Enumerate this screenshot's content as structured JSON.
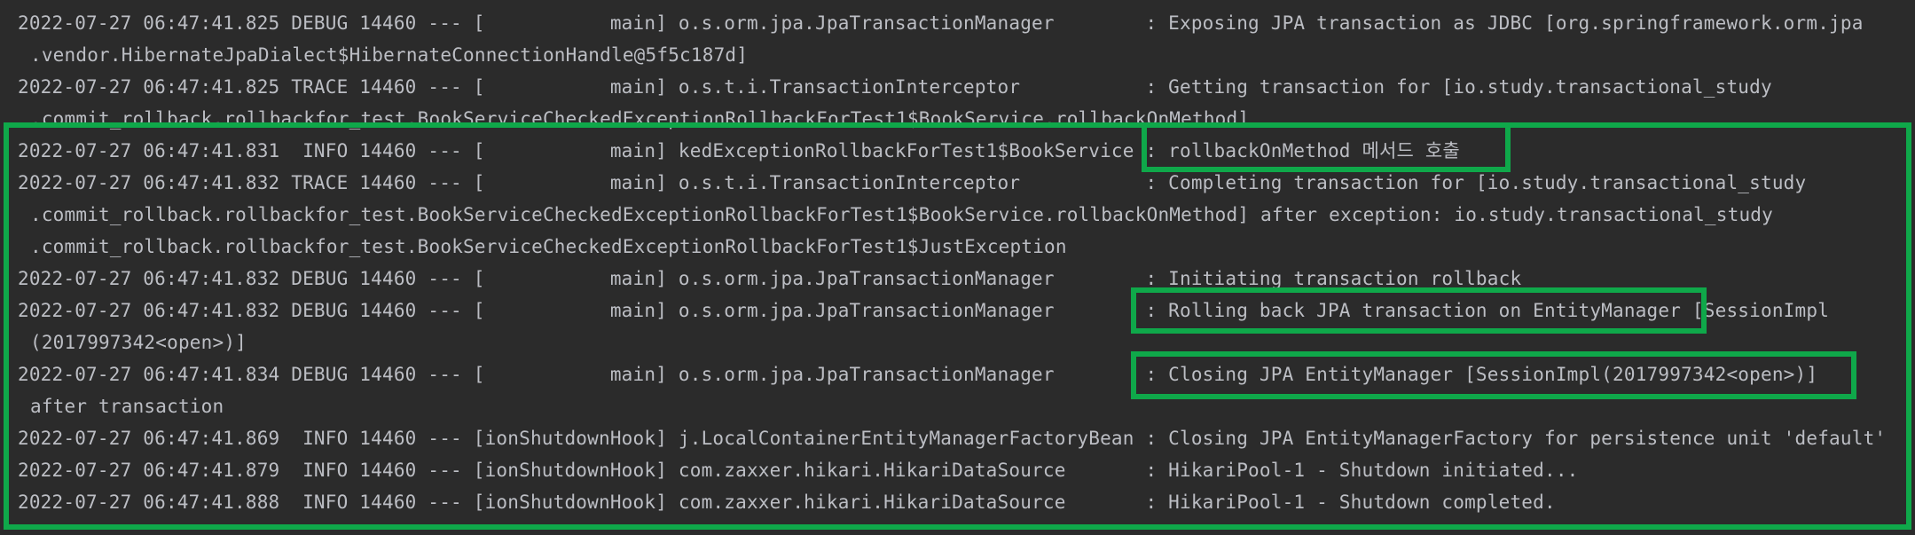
{
  "console": {
    "lines": [
      "2022-07-27 06:47:41.825 DEBUG 14460 --- [           main] o.s.orm.jpa.JpaTransactionManager        : Exposing JPA transaction as JDBC [org.springframework.orm.jpa",
      ".vendor.HibernateJpaDialect$HibernateConnectionHandle@5f5c187d]",
      "2022-07-27 06:47:41.825 TRACE 14460 --- [           main] o.s.t.i.TransactionInterceptor           : Getting transaction for [io.study.transactional_study",
      ".commit_rollback.rollbackfor_test.BookServiceCheckedExceptionRollbackForTest1$BookService.rollbackOnMethod]",
      "2022-07-27 06:47:41.831  INFO 14460 --- [           main] kedExceptionRollbackForTest1$BookService : rollbackOnMethod 메서드 호출",
      "2022-07-27 06:47:41.832 TRACE 14460 --- [           main] o.s.t.i.TransactionInterceptor           : Completing transaction for [io.study.transactional_study",
      ".commit_rollback.rollbackfor_test.BookServiceCheckedExceptionRollbackForTest1$BookService.rollbackOnMethod] after exception: io.study.transactional_study",
      ".commit_rollback.rollbackfor_test.BookServiceCheckedExceptionRollbackForTest1$JustException",
      "2022-07-27 06:47:41.832 DEBUG 14460 --- [           main] o.s.orm.jpa.JpaTransactionManager        : Initiating transaction rollback",
      "2022-07-27 06:47:41.832 DEBUG 14460 --- [           main] o.s.orm.jpa.JpaTransactionManager        : Rolling back JPA transaction on EntityManager [SessionImpl",
      "(2017997342<open>)]",
      "2022-07-27 06:47:41.834 DEBUG 14460 --- [           main] o.s.orm.jpa.JpaTransactionManager        : Closing JPA EntityManager [SessionImpl(2017997342<open>)]",
      "after transaction",
      "2022-07-27 06:47:41.869  INFO 14460 --- [ionShutdownHook] j.LocalContainerEntityManagerFactoryBean : Closing JPA EntityManagerFactory for persistence unit 'default'",
      "2022-07-27 06:47:41.879  INFO 14460 --- [ionShutdownHook] com.zaxxer.hikari.HikariDataSource       : HikariPool-1 - Shutdown initiated...",
      "2022-07-27 06:47:41.888  INFO 14460 --- [ionShutdownHook] com.zaxxer.hikari.HikariDataSource       : HikariPool-1 - Shutdown completed."
    ]
  },
  "highlight_color": "#0fa84a",
  "text_color": "#bcbec4",
  "background_color": "#2b2b2b"
}
